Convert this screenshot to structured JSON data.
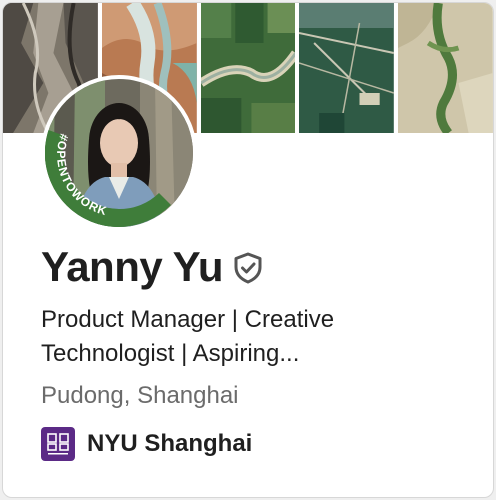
{
  "profile": {
    "name": "Yanny Yu",
    "headline_line1": "Product Manager | Creative",
    "headline_line2": "Technologist | Aspiring...",
    "location": "Pudong, Shanghai",
    "badge_text": "#OPENTOWORK",
    "verified_icon": "shield-check-icon"
  },
  "education": {
    "school": "NYU Shanghai",
    "logo_icon": "nyu-shanghai-logo"
  },
  "colors": {
    "name": "#1f1f1f",
    "location": "#6b6b6b",
    "open_to_work_ring": "#3f7d3a",
    "school_logo_bg": "#5b2a86"
  }
}
